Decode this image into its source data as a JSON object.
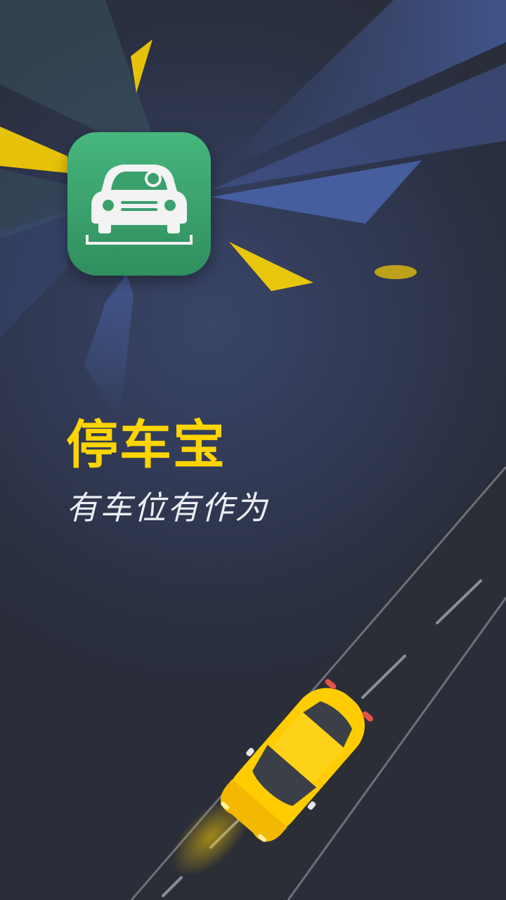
{
  "splash": {
    "app_name": "停车宝",
    "slogan": "有车位有作为",
    "app_icon": "car-parking-icon",
    "car_icon": "yellow-car-illustration"
  },
  "colors": {
    "background": "#2b3040",
    "title": "#ffd500",
    "slogan": "#eceef3",
    "icon_green": "#3aa06c",
    "road": "#2e3038",
    "car_yellow": "#ffcc00"
  }
}
